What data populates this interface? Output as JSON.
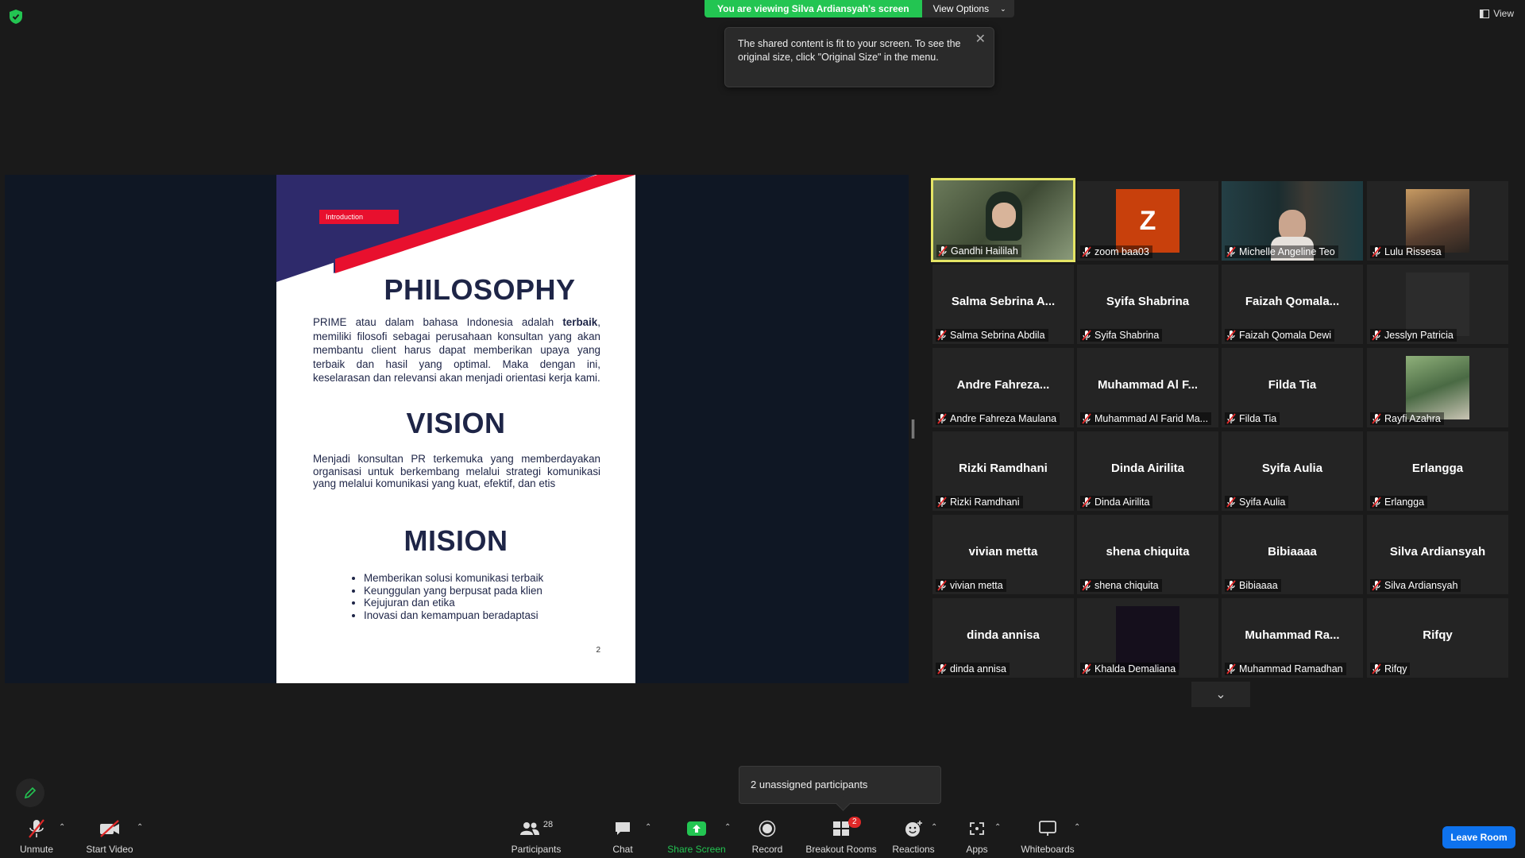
{
  "banner": {
    "viewing_text": "You are viewing Silva Ardiansyah's screen",
    "options_label": "View Options"
  },
  "view_label": "View",
  "tooltip": {
    "text": "The shared content is fit to your screen. To see the original size, click \"Original Size\" in the menu."
  },
  "slide": {
    "tag": "Introduction",
    "philosophy_title": "PHILOSOPHY",
    "philosophy_pre": "PRIME atau dalam bahasa Indonesia adalah ",
    "philosophy_bold": "terbaik",
    "philosophy_post": ", memiliki filosofi sebagai perusahaan konsultan yang akan membantu client harus dapat memberikan upaya yang terbaik dan hasil yang optimal. Maka dengan ini, keselarasan dan relevansi akan menjadi orientasi kerja kami.",
    "vision_title": "VISION",
    "vision_text": "Menjadi konsultan PR terkemuka yang memberdayakan organisasi untuk berkembang melalui strategi komunikasi yang melalui komunikasi yang kuat, efektif, dan etis",
    "mision_title": "MISION",
    "mision_items": [
      "Memberikan solusi komunikasi terbaik",
      "Keunggulan yang berpusat pada klien",
      "Kejujuran dan etika",
      "Inovasi dan kemampuan beradaptasi"
    ],
    "page_number": "2"
  },
  "gallery": [
    {
      "display": "",
      "label": "Gandhi Haililah"
    },
    {
      "display": "Z",
      "label": "zoom baa03"
    },
    {
      "display": "",
      "label": "Michelle Angeline Teo"
    },
    {
      "display": "",
      "label": "Lulu Rissesa"
    },
    {
      "display": "Salma Sebrina A...",
      "label": "Salma Sebrina Abdila"
    },
    {
      "display": "Syifa Shabrina",
      "label": "Syifa Shabrina"
    },
    {
      "display": "Faizah Qomala...",
      "label": "Faizah Qomala Dewi"
    },
    {
      "display": "",
      "label": "Jesslyn Patricia"
    },
    {
      "display": "Andre Fahreza...",
      "label": "Andre Fahreza Maulana"
    },
    {
      "display": "Muhammad Al F...",
      "label": "Muhammad Al Farid Ma..."
    },
    {
      "display": "Filda Tia",
      "label": "Filda Tia"
    },
    {
      "display": "",
      "label": "Rayfi Azahra"
    },
    {
      "display": "Rizki Ramdhani",
      "label": "Rizki Ramdhani"
    },
    {
      "display": "Dinda Airilita",
      "label": "Dinda Airilita"
    },
    {
      "display": "Syifa Aulia",
      "label": "Syifa Aulia"
    },
    {
      "display": "Erlangga",
      "label": "Erlangga"
    },
    {
      "display": "vivian metta",
      "label": "vivian metta"
    },
    {
      "display": "shena chiquita",
      "label": "shena chiquita"
    },
    {
      "display": "Bibiaaaa",
      "label": "Bibiaaaa"
    },
    {
      "display": "Silva Ardiansyah",
      "label": "Silva Ardiansyah"
    },
    {
      "display": "dinda annisa",
      "label": "dinda annisa"
    },
    {
      "display": "",
      "label": "Khalda Demaliana"
    },
    {
      "display": "Muhammad Ra...",
      "label": "Muhammad Ramadhan"
    },
    {
      "display": "Rifqy",
      "label": "Rifqy"
    }
  ],
  "unassigned": "2 unassigned participants",
  "toolbar": {
    "unmute": "Unmute",
    "start_video": "Start Video",
    "participants": "Participants",
    "participants_count": "28",
    "chat": "Chat",
    "share_screen": "Share Screen",
    "record": "Record",
    "breakout_rooms": "Breakout Rooms",
    "breakout_badge": "2",
    "reactions": "Reactions",
    "apps": "Apps",
    "whiteboards": "Whiteboards",
    "leave": "Leave Room"
  },
  "colors": {
    "share_green": "#23c552",
    "leave_blue": "#0e72ed",
    "mute_red": "#e02828",
    "slide_navy": "#2e2a6b",
    "slide_red": "#e8102e",
    "active_speaker": "#e5e565"
  }
}
